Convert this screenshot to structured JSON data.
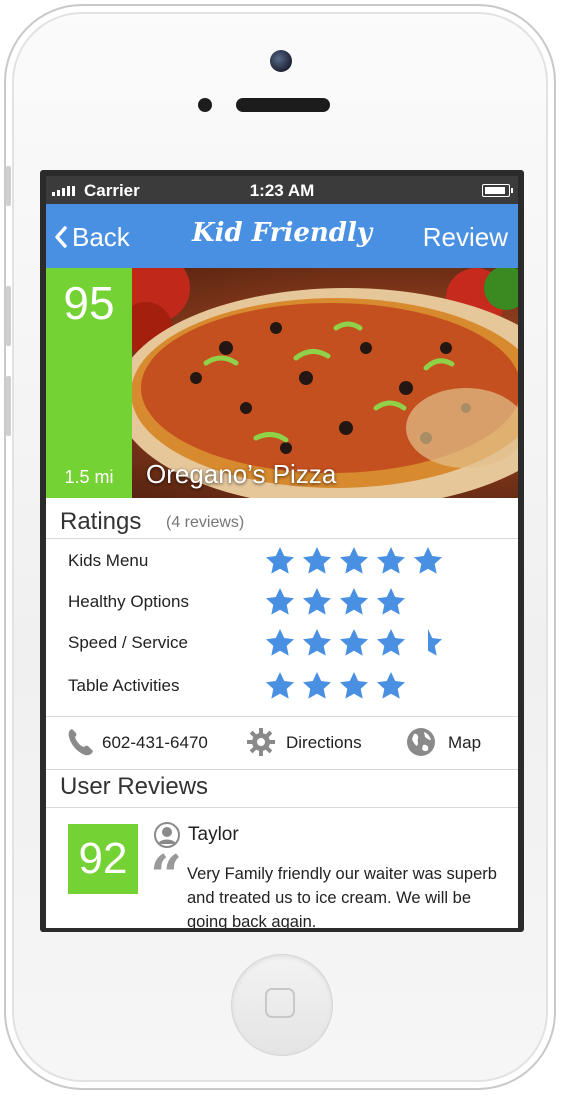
{
  "status_bar": {
    "carrier": "Carrier",
    "time": "1:23 AM"
  },
  "nav": {
    "back_label": "Back",
    "title": "Kid Friendly",
    "review_label": "Review"
  },
  "restaurant": {
    "score": "95",
    "distance": "1.5 mi",
    "name": "Oregano’s Pizza"
  },
  "ratings": {
    "title": "Ratings",
    "review_count": "(4 reviews)",
    "items": [
      {
        "label": "Kids Menu",
        "stars": 5
      },
      {
        "label": "Healthy Options",
        "stars": 4
      },
      {
        "label": "Speed / Service",
        "stars": 4.5
      },
      {
        "label": "Table Activities",
        "stars": 4
      }
    ]
  },
  "actions": {
    "phone": "602-431-6470",
    "directions": "Directions",
    "map": "Map"
  },
  "user_reviews": {
    "title": "User Reviews",
    "items": [
      {
        "score": "92",
        "name": "Taylor",
        "text": "Very Family friendly our waiter was superb and treated us to ice cream. We will be going back again."
      }
    ]
  },
  "colors": {
    "nav_blue": "#4a90e2",
    "score_green": "#75d234",
    "star_blue": "#4a90e2"
  },
  "icons": [
    "signal-icon",
    "battery-icon",
    "chevron-left-icon",
    "phone-icon",
    "gear-icon",
    "globe-icon",
    "user-icon",
    "quote-icon",
    "star-icon"
  ]
}
